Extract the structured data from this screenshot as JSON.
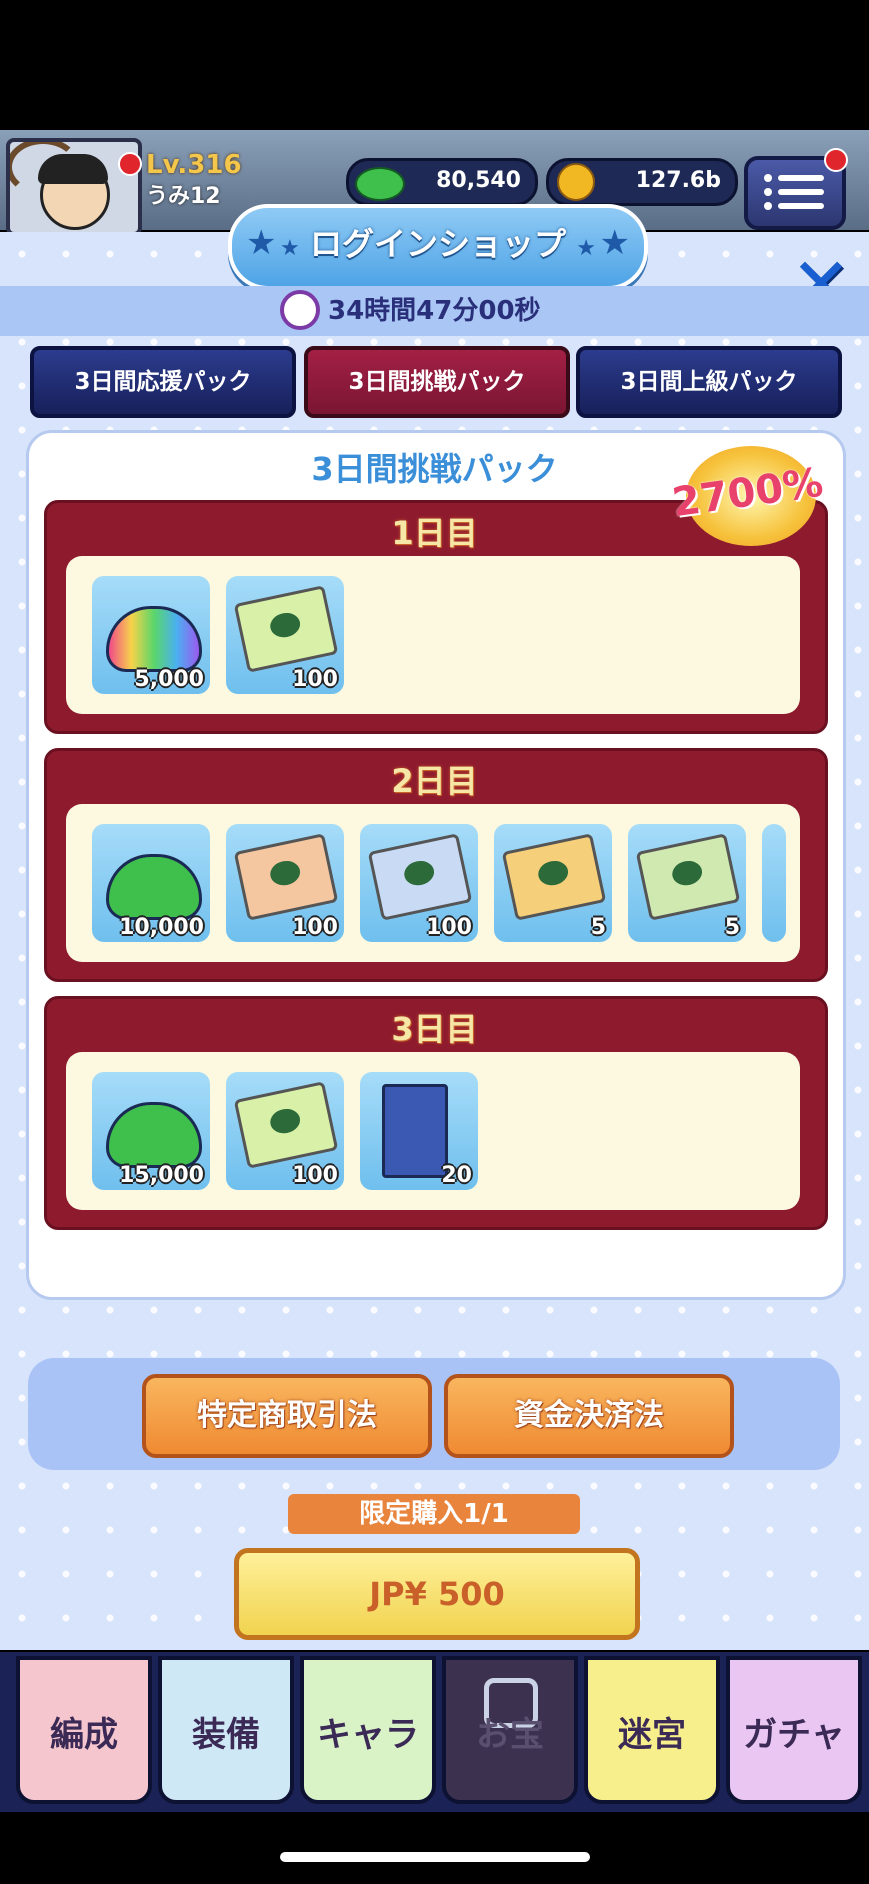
{
  "hud": {
    "level": "Lv.316",
    "username": "うみ12",
    "currency_green": "80,540",
    "currency_gold": "127.6b"
  },
  "shop": {
    "title": "ログインショップ",
    "timer": "34時間47分00秒",
    "tabs": [
      "3日間応援パック",
      "3日間挑戦パック",
      "3日間上級パック"
    ],
    "active_tab": 1,
    "pack_title": "3日間挑戦パック",
    "badge": "2700%",
    "days": [
      {
        "label": "1日目",
        "items": [
          {
            "icon": "rainbow-cloud-icon",
            "count": "5,000"
          },
          {
            "icon": "gacha-ticket-icon",
            "count": "100"
          }
        ]
      },
      {
        "label": "2日目",
        "items": [
          {
            "icon": "green-cloud-icon",
            "count": "10,000"
          },
          {
            "icon": "red-gacha-ticket-icon",
            "count": "100"
          },
          {
            "icon": "blue-gacha-ticket-icon",
            "count": "100"
          },
          {
            "icon": "uma-ticket-icon",
            "count": "5"
          },
          {
            "icon": "green-ticket-icon",
            "count": "5"
          }
        ]
      },
      {
        "label": "3日目",
        "items": [
          {
            "icon": "green-cloud-icon",
            "count": "15,000"
          },
          {
            "icon": "gacha-ticket-icon",
            "count": "100"
          },
          {
            "icon": "locker-icon",
            "count": "20"
          }
        ]
      }
    ],
    "buttons": {
      "commerce_law": "特定商取引法",
      "payment_law": "資金決済法"
    },
    "limit": "限定購入1/1",
    "price": "JP¥ 500"
  },
  "nav": [
    "編成",
    "装備",
    "キャラ",
    "お宝",
    "迷宮",
    "ガチャ"
  ],
  "colors": {
    "tab_active": "#a32045",
    "tab_inactive": "#1f2a6e",
    "day_frame": "#8e1a2e",
    "accent_blue": "#3b8fd8",
    "buy_button": "#f1d34f"
  }
}
